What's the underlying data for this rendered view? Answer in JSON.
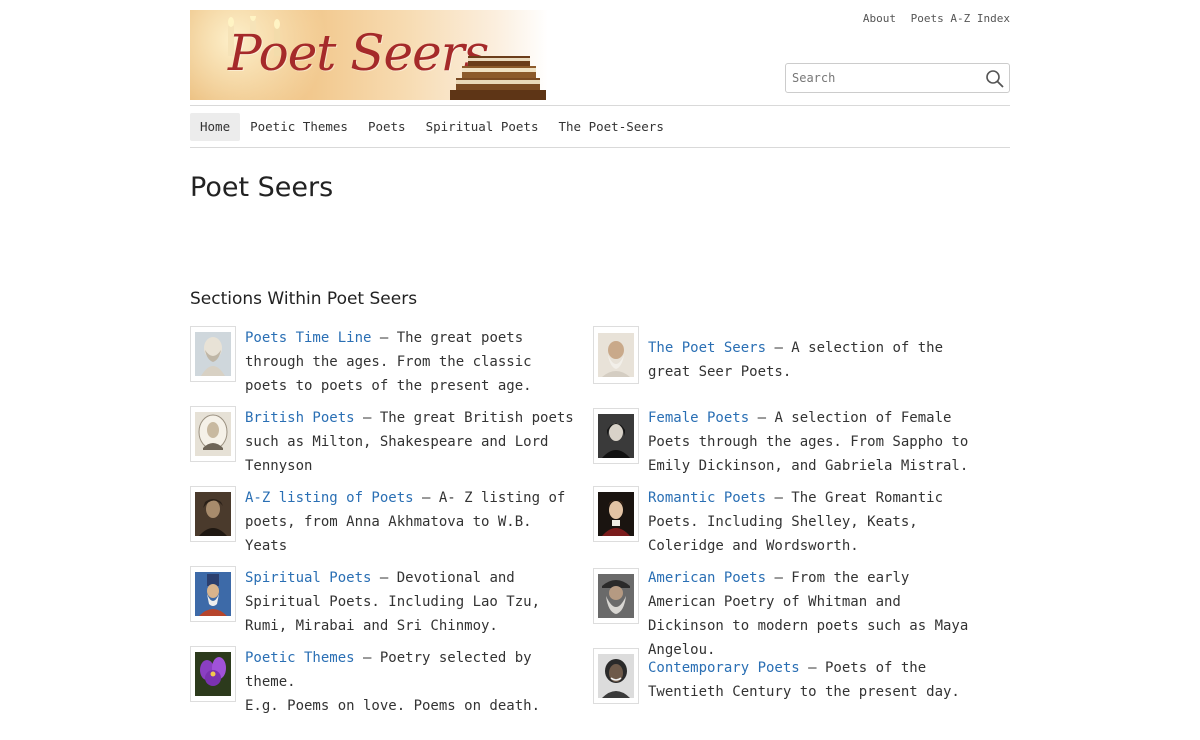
{
  "header": {
    "logo_text": "Poet Seers",
    "top_links": [
      "About",
      "Poets A-Z Index"
    ],
    "search": {
      "placeholder": "Search"
    }
  },
  "nav": {
    "items": [
      "Home",
      "Poetic Themes",
      "Poets",
      "Spiritual Poets",
      "The Poet-Seers"
    ],
    "active": "Home"
  },
  "main": {
    "title": "Poet Seers",
    "sections_heading": "Sections Within Poet Seers",
    "left": [
      {
        "link": "Poets Time Line",
        "text": " – The great poets through the ages. From the classic poets to poets of the present age.",
        "icon": "bust-icon"
      },
      {
        "link": "British Poets",
        "text": " – The great British poets such as Milton, Shakespeare and Lord Tennyson",
        "icon": "portrait-icon"
      },
      {
        "link": "A-Z listing of Poets",
        "text": " – A- Z listing of poets, from Anna Akhmatova to W.B. Yeats",
        "icon": "portrait-icon"
      },
      {
        "link": "Spiritual Poets",
        "text": " – Devotional and Spiritual Poets. Including Lao Tzu, Rumi, Mirabai and Sri Chinmoy.",
        "icon": "portrait-icon"
      },
      {
        "link": "Poetic Themes",
        "text": " – Poetry selected by theme.",
        "extra": "E.g. Poems on love. Poems on death.",
        "icon": "flower-icon"
      }
    ],
    "right": [
      {
        "link": "The Poet Seers",
        "text": " – A selection of the great Seer Poets.",
        "icon": "portrait-icon"
      },
      {
        "link": "Female Poets",
        "text": " – A selection of Female Poets through the ages. From Sappho to Emily Dickinson, and Gabriela Mistral.",
        "icon": "portrait-icon"
      },
      {
        "link": "Romantic Poets",
        "text": " – The Great Romantic Poets. Including Shelley, Keats, Coleridge and Wordsworth.",
        "icon": "portrait-icon"
      },
      {
        "link": "American Poets",
        "text": " – From the early American Poetry of Whitman and Dickinson to modern poets such as Maya Angelou.",
        "icon": "portrait-icon"
      },
      {
        "link": "Contemporary Poets",
        "text": " – Poets of the Twentieth Century to the present day.",
        "icon": "portrait-icon"
      }
    ]
  }
}
